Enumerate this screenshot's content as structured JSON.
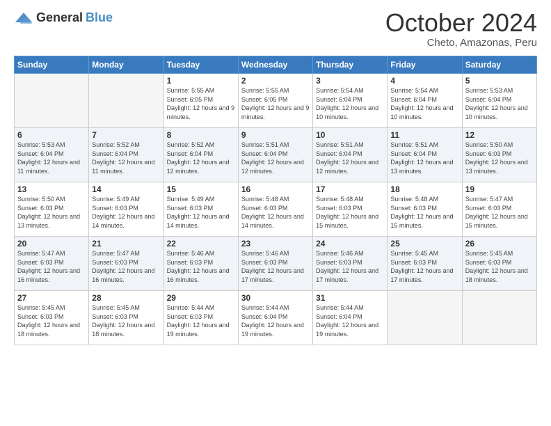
{
  "header": {
    "logo_general": "General",
    "logo_blue": "Blue",
    "month_title": "October 2024",
    "location": "Cheto, Amazonas, Peru"
  },
  "weekdays": [
    "Sunday",
    "Monday",
    "Tuesday",
    "Wednesday",
    "Thursday",
    "Friday",
    "Saturday"
  ],
  "weeks": [
    [
      {
        "day": "",
        "sunrise": "",
        "sunset": "",
        "daylight": "",
        "empty": true
      },
      {
        "day": "",
        "sunrise": "",
        "sunset": "",
        "daylight": "",
        "empty": true
      },
      {
        "day": "1",
        "sunrise": "Sunrise: 5:55 AM",
        "sunset": "Sunset: 6:05 PM",
        "daylight": "Daylight: 12 hours and 9 minutes."
      },
      {
        "day": "2",
        "sunrise": "Sunrise: 5:55 AM",
        "sunset": "Sunset: 6:05 PM",
        "daylight": "Daylight: 12 hours and 9 minutes."
      },
      {
        "day": "3",
        "sunrise": "Sunrise: 5:54 AM",
        "sunset": "Sunset: 6:04 PM",
        "daylight": "Daylight: 12 hours and 10 minutes."
      },
      {
        "day": "4",
        "sunrise": "Sunrise: 5:54 AM",
        "sunset": "Sunset: 6:04 PM",
        "daylight": "Daylight: 12 hours and 10 minutes."
      },
      {
        "day": "5",
        "sunrise": "Sunrise: 5:53 AM",
        "sunset": "Sunset: 6:04 PM",
        "daylight": "Daylight: 12 hours and 10 minutes."
      }
    ],
    [
      {
        "day": "6",
        "sunrise": "Sunrise: 5:53 AM",
        "sunset": "Sunset: 6:04 PM",
        "daylight": "Daylight: 12 hours and 11 minutes."
      },
      {
        "day": "7",
        "sunrise": "Sunrise: 5:52 AM",
        "sunset": "Sunset: 6:04 PM",
        "daylight": "Daylight: 12 hours and 11 minutes."
      },
      {
        "day": "8",
        "sunrise": "Sunrise: 5:52 AM",
        "sunset": "Sunset: 6:04 PM",
        "daylight": "Daylight: 12 hours and 12 minutes."
      },
      {
        "day": "9",
        "sunrise": "Sunrise: 5:51 AM",
        "sunset": "Sunset: 6:04 PM",
        "daylight": "Daylight: 12 hours and 12 minutes."
      },
      {
        "day": "10",
        "sunrise": "Sunrise: 5:51 AM",
        "sunset": "Sunset: 6:04 PM",
        "daylight": "Daylight: 12 hours and 12 minutes."
      },
      {
        "day": "11",
        "sunrise": "Sunrise: 5:51 AM",
        "sunset": "Sunset: 6:04 PM",
        "daylight": "Daylight: 12 hours and 13 minutes."
      },
      {
        "day": "12",
        "sunrise": "Sunrise: 5:50 AM",
        "sunset": "Sunset: 6:03 PM",
        "daylight": "Daylight: 12 hours and 13 minutes."
      }
    ],
    [
      {
        "day": "13",
        "sunrise": "Sunrise: 5:50 AM",
        "sunset": "Sunset: 6:03 PM",
        "daylight": "Daylight: 12 hours and 13 minutes."
      },
      {
        "day": "14",
        "sunrise": "Sunrise: 5:49 AM",
        "sunset": "Sunset: 6:03 PM",
        "daylight": "Daylight: 12 hours and 14 minutes."
      },
      {
        "day": "15",
        "sunrise": "Sunrise: 5:49 AM",
        "sunset": "Sunset: 6:03 PM",
        "daylight": "Daylight: 12 hours and 14 minutes."
      },
      {
        "day": "16",
        "sunrise": "Sunrise: 5:48 AM",
        "sunset": "Sunset: 6:03 PM",
        "daylight": "Daylight: 12 hours and 14 minutes."
      },
      {
        "day": "17",
        "sunrise": "Sunrise: 5:48 AM",
        "sunset": "Sunset: 6:03 PM",
        "daylight": "Daylight: 12 hours and 15 minutes."
      },
      {
        "day": "18",
        "sunrise": "Sunrise: 5:48 AM",
        "sunset": "Sunset: 6:03 PM",
        "daylight": "Daylight: 12 hours and 15 minutes."
      },
      {
        "day": "19",
        "sunrise": "Sunrise: 5:47 AM",
        "sunset": "Sunset: 6:03 PM",
        "daylight": "Daylight: 12 hours and 15 minutes."
      }
    ],
    [
      {
        "day": "20",
        "sunrise": "Sunrise: 5:47 AM",
        "sunset": "Sunset: 6:03 PM",
        "daylight": "Daylight: 12 hours and 16 minutes."
      },
      {
        "day": "21",
        "sunrise": "Sunrise: 5:47 AM",
        "sunset": "Sunset: 6:03 PM",
        "daylight": "Daylight: 12 hours and 16 minutes."
      },
      {
        "day": "22",
        "sunrise": "Sunrise: 5:46 AM",
        "sunset": "Sunset: 6:03 PM",
        "daylight": "Daylight: 12 hours and 16 minutes."
      },
      {
        "day": "23",
        "sunrise": "Sunrise: 5:46 AM",
        "sunset": "Sunset: 6:03 PM",
        "daylight": "Daylight: 12 hours and 17 minutes."
      },
      {
        "day": "24",
        "sunrise": "Sunrise: 5:46 AM",
        "sunset": "Sunset: 6:03 PM",
        "daylight": "Daylight: 12 hours and 17 minutes."
      },
      {
        "day": "25",
        "sunrise": "Sunrise: 5:45 AM",
        "sunset": "Sunset: 6:03 PM",
        "daylight": "Daylight: 12 hours and 17 minutes."
      },
      {
        "day": "26",
        "sunrise": "Sunrise: 5:45 AM",
        "sunset": "Sunset: 6:03 PM",
        "daylight": "Daylight: 12 hours and 18 minutes."
      }
    ],
    [
      {
        "day": "27",
        "sunrise": "Sunrise: 5:45 AM",
        "sunset": "Sunset: 6:03 PM",
        "daylight": "Daylight: 12 hours and 18 minutes."
      },
      {
        "day": "28",
        "sunrise": "Sunrise: 5:45 AM",
        "sunset": "Sunset: 6:03 PM",
        "daylight": "Daylight: 12 hours and 18 minutes."
      },
      {
        "day": "29",
        "sunrise": "Sunrise: 5:44 AM",
        "sunset": "Sunset: 6:03 PM",
        "daylight": "Daylight: 12 hours and 19 minutes."
      },
      {
        "day": "30",
        "sunrise": "Sunrise: 5:44 AM",
        "sunset": "Sunset: 6:04 PM",
        "daylight": "Daylight: 12 hours and 19 minutes."
      },
      {
        "day": "31",
        "sunrise": "Sunrise: 5:44 AM",
        "sunset": "Sunset: 6:04 PM",
        "daylight": "Daylight: 12 hours and 19 minutes."
      },
      {
        "day": "",
        "sunrise": "",
        "sunset": "",
        "daylight": "",
        "empty": true
      },
      {
        "day": "",
        "sunrise": "",
        "sunset": "",
        "daylight": "",
        "empty": true
      }
    ]
  ]
}
